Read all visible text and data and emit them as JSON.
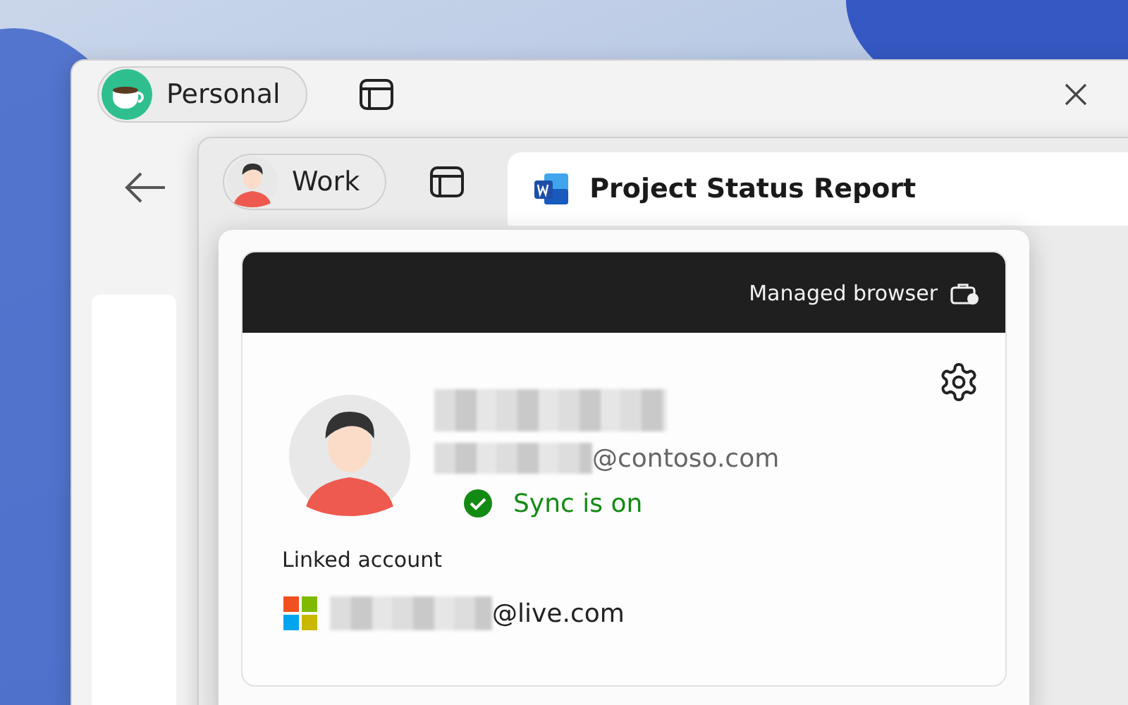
{
  "back_window": {
    "profile": {
      "label": "Personal"
    }
  },
  "front_window": {
    "profile": {
      "label": "Work"
    },
    "tab": {
      "title": "Project Status Report",
      "selected": true
    }
  },
  "profile_panel": {
    "header": {
      "label": "Managed browser"
    },
    "account": {
      "email_domain": "@contoso.com",
      "sync": {
        "label": "Sync is on",
        "on": true
      }
    },
    "linked": {
      "heading": "Linked account",
      "email_domain": "@live.com"
    }
  }
}
